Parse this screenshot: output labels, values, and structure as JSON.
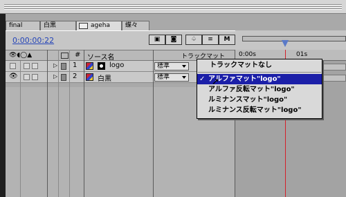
{
  "tabs": [
    {
      "label": "final"
    },
    {
      "label": "白黒"
    },
    {
      "label": "ageha"
    },
    {
      "label": "蝶々"
    }
  ],
  "timecode": "0:00:00:22",
  "toolbar_icons": [
    "resolution-icon",
    "shy-icon",
    "draft-3d-icon",
    "frame-blend-icon",
    "motion-blur-icon"
  ],
  "columns": {
    "number": "#",
    "source_name": "ソース名",
    "track_matte": "トラックマット"
  },
  "ruler": {
    "start": "0:00s",
    "mark1": "01s"
  },
  "layers": [
    {
      "number": "1",
      "name": "logo",
      "mode": "標準",
      "color": "#7a7a7a"
    },
    {
      "number": "2",
      "name": "白黒",
      "mode": "標準",
      "color": "#7a7a7a"
    }
  ],
  "menu": {
    "items": [
      {
        "label": "トラックマットなし",
        "checked": false,
        "selected": false
      },
      {
        "label": "アルファマット\"logo\"",
        "checked": true,
        "selected": true
      },
      {
        "label": "アルファ反転マット\"logo\"",
        "checked": false,
        "selected": false
      },
      {
        "label": "ルミナンスマット\"logo\"",
        "checked": false,
        "selected": false
      },
      {
        "label": "ルミナンス反転マット\"logo\"",
        "checked": false,
        "selected": false
      }
    ]
  },
  "colors": {
    "accent": "#1b1fa8",
    "playhead": "#d4202a",
    "timecode": "#2444b8"
  }
}
